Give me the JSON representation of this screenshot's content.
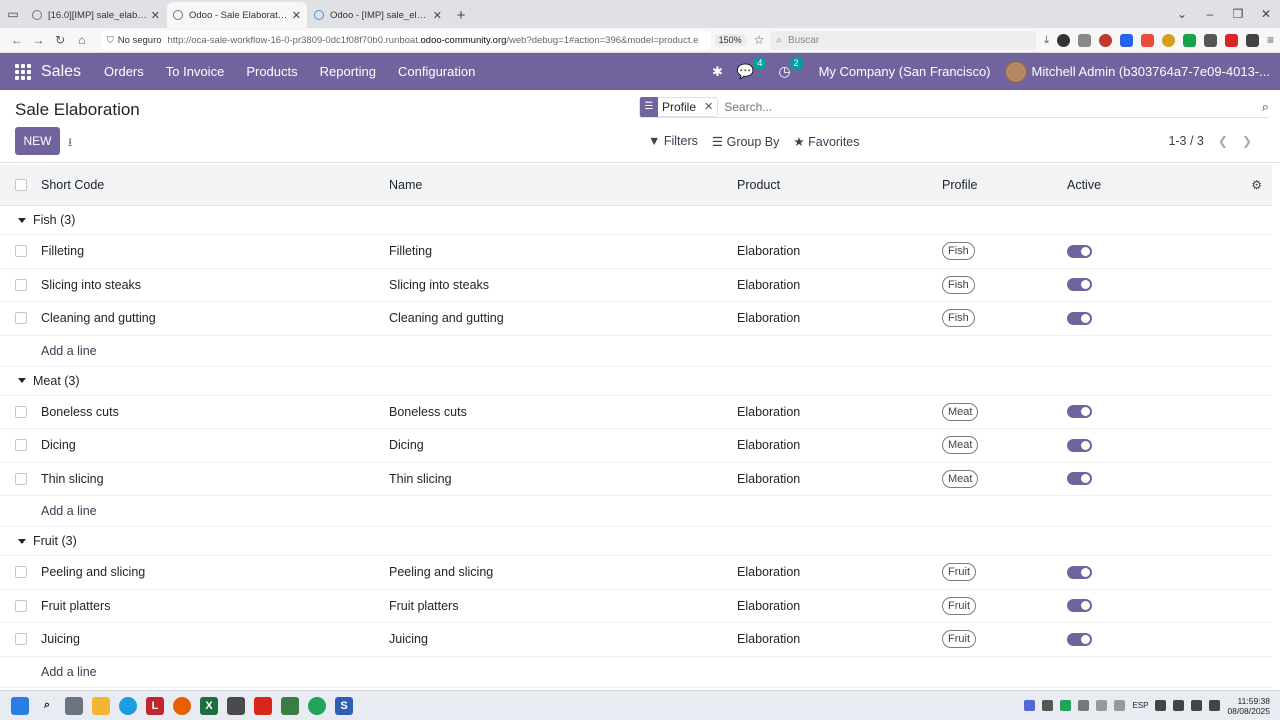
{
  "browser": {
    "tabs": [
      {
        "label": "[16.0][IMP] sale_elaboration: ·",
        "active": false
      },
      {
        "label": "Odoo - Sale Elaboration",
        "active": true
      },
      {
        "label": "Odoo - [IMP] sale_elaboration: ·",
        "active": false
      }
    ],
    "url_insecure": "No seguro",
    "url_prefix": "http://oca-sale-workflow-16-0-pr3809-0dc1f08f70b0.runboat.",
    "url_domain": "odoo-community.org",
    "url_suffix": "/web?debug=1#action=396&model=product.e",
    "zoom": "150%",
    "search_placeholder": "Buscar"
  },
  "navbar": {
    "app": "Sales",
    "menu": [
      "Orders",
      "To Invoice",
      "Products",
      "Reporting",
      "Configuration"
    ],
    "messages_count": "4",
    "activities_count": "2",
    "company": "My Company (San Francisco)",
    "user": "Mitchell Admin (b303764a7-7e09-4013-..."
  },
  "control_panel": {
    "title": "Sale Elaboration",
    "new_label": "NEW",
    "facet_label": "Profile",
    "search_placeholder": "Search...",
    "filters_label": "Filters",
    "groupby_label": "Group By",
    "favorites_label": "Favorites",
    "pager": "1-3 / 3"
  },
  "list": {
    "columns": [
      "Short Code",
      "Name",
      "Product",
      "Profile",
      "Active"
    ],
    "add_line": "Add a line",
    "groups": [
      {
        "label": "Fish (3)",
        "rows": [
          {
            "code": "Filleting",
            "name": "Filleting",
            "product": "Elaboration",
            "profile": "Fish"
          },
          {
            "code": "Slicing into steaks",
            "name": "Slicing into steaks",
            "product": "Elaboration",
            "profile": "Fish"
          },
          {
            "code": "Cleaning and gutting",
            "name": "Cleaning and gutting",
            "product": "Elaboration",
            "profile": "Fish"
          }
        ]
      },
      {
        "label": "Meat (3)",
        "rows": [
          {
            "code": "Boneless cuts",
            "name": "Boneless cuts",
            "product": "Elaboration",
            "profile": "Meat"
          },
          {
            "code": "Dicing",
            "name": "Dicing",
            "product": "Elaboration",
            "profile": "Meat"
          },
          {
            "code": "Thin slicing",
            "name": "Thin slicing",
            "product": "Elaboration",
            "profile": "Meat"
          }
        ]
      },
      {
        "label": "Fruit (3)",
        "rows": [
          {
            "code": "Peeling and slicing",
            "name": "Peeling and slicing",
            "product": "Elaboration",
            "profile": "Fruit"
          },
          {
            "code": "Fruit platters",
            "name": "Fruit platters",
            "product": "Elaboration",
            "profile": "Fruit"
          },
          {
            "code": "Juicing",
            "name": "Juicing",
            "product": "Elaboration",
            "profile": "Fruit"
          }
        ]
      }
    ]
  },
  "taskbar": {
    "lang": "ESP",
    "time": "11:59:38",
    "date": "08/08/2025"
  },
  "colors": {
    "brand": "#71639e",
    "tab_strip": "#dfe1e5",
    "header_row": "#f2f3f5"
  }
}
